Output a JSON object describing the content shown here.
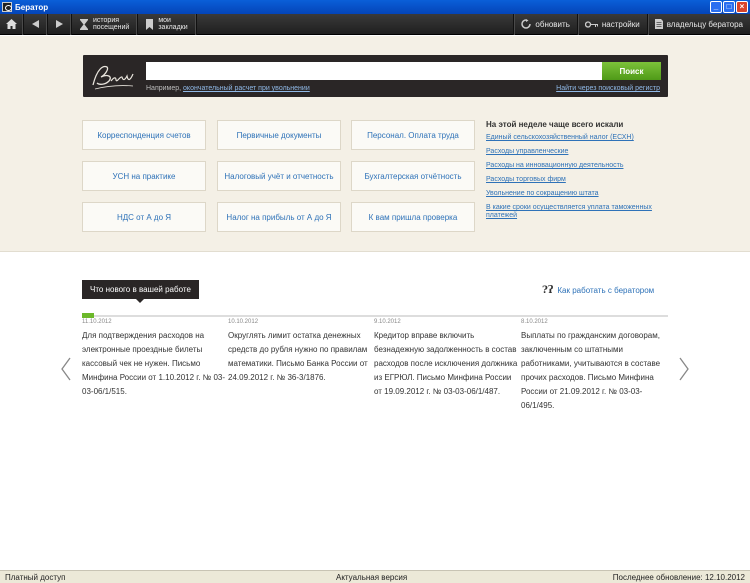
{
  "window": {
    "title": "Бератор"
  },
  "toolbar": {
    "history_label_1": "история",
    "history_label_2": "посещений",
    "bookmarks_label_1": "мои",
    "bookmarks_label_2": "закладки",
    "refresh_label": "обновить",
    "settings_label": "настройки",
    "owner_label": "владельцу бератора"
  },
  "search": {
    "placeholder": "",
    "button_label": "Поиск",
    "example_prefix": "Например, ",
    "example_link": "окончательный расчет при увольнении",
    "registry_link": "Найти через поисковый регистр"
  },
  "categories": [
    "Корреспонденция счетов",
    "Первичные документы",
    "Персонал. Оплата труда",
    "УСН на практике",
    "Налоговый учёт и отчетность",
    "Бухгалтерская отчётность",
    "НДС от А до Я",
    "Налог на прибыль от А до Я",
    "К вам пришла проверка"
  ],
  "popular": {
    "heading": "На этой неделе чаще всего искали",
    "links": [
      "Единый сельскохозяйственный налог (ЕСХН)",
      "Расходы управленческие",
      "Расходы на инновационную деятельность",
      "Расходы торговых фирм",
      "Увольнение по сокращению штата",
      "В какие сроки осуществляется уплата таможенных платежей"
    ]
  },
  "news": {
    "tab_label": "Что нового в вашей работе",
    "howto_label": "Как работать с бератором",
    "howto_icon": "question-icon",
    "items": [
      {
        "date": "11.10.2012",
        "text": "Для подтверждения расходов на электронные проездные билеты кассовый чек не нужен. Письмо Минфина России от 1.10.2012 г. № 03-03-06/1/515."
      },
      {
        "date": "10.10.2012",
        "text": "Округлять лимит остатка денежных средств до рубля нужно по правилам математики. Письмо Банка России от 24.09.2012 г. № 36-3/1876."
      },
      {
        "date": "9.10.2012",
        "text": "Кредитор вправе включить безнадежную задолженность в состав расходов после исключения должника из ЕГРЮЛ. Письмо Минфина России от 19.09.2012 г. № 03-03-06/1/487."
      },
      {
        "date": "8.10.2012",
        "text": "Выплаты по гражданским договорам, заключенным со штатными работниками, учитываются в составе прочих расходов. Письмо Минфина России от 21.09.2012 г. № 03-03-06/1/495."
      }
    ]
  },
  "status": {
    "access": "Платный доступ",
    "version": "Актуальная версия",
    "updated": "Последнее обновление: 12.10.2012"
  },
  "colors": {
    "accent": "#2e72b8",
    "brand_dark": "#2a2626",
    "search_green": "#5fa820",
    "hero_bg": "#f4f0e6"
  }
}
